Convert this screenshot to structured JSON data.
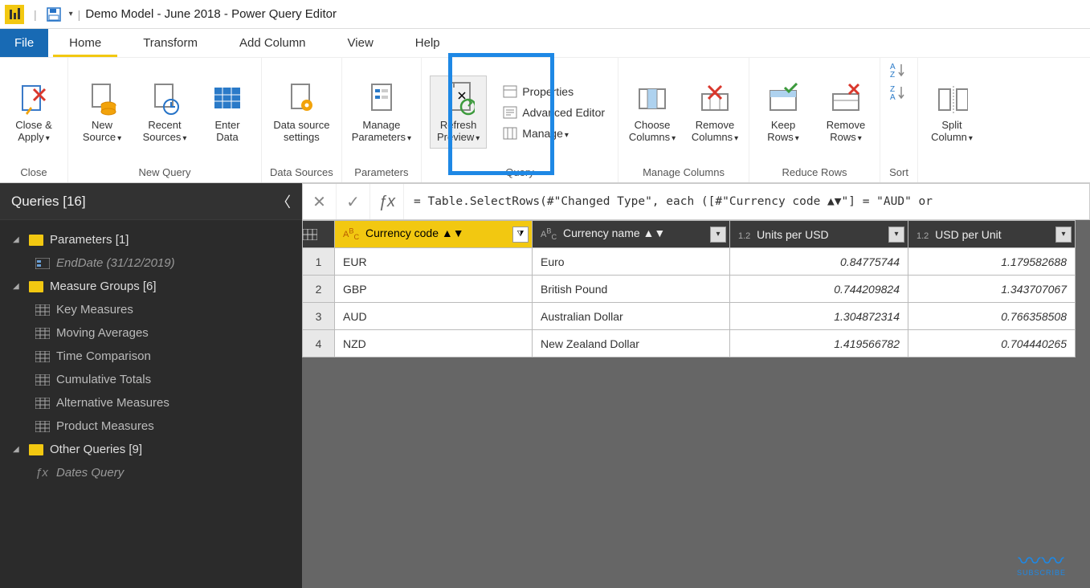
{
  "titlebar": {
    "title": "Demo Model - June 2018 - Power Query Editor"
  },
  "tabs": {
    "file": "File",
    "items": [
      "Home",
      "Transform",
      "Add Column",
      "View",
      "Help"
    ],
    "active": "Home"
  },
  "ribbon": {
    "close": {
      "close_apply": "Close &\nApply",
      "group": "Close"
    },
    "newquery": {
      "new_source": "New\nSource",
      "recent_sources": "Recent\nSources",
      "enter_data": "Enter\nData",
      "group": "New Query"
    },
    "datasources": {
      "settings": "Data source\nsettings",
      "group": "Data Sources"
    },
    "parameters": {
      "manage": "Manage\nParameters",
      "group": "Parameters"
    },
    "query": {
      "refresh": "Refresh\nPreview",
      "properties": "Properties",
      "advanced": "Advanced Editor",
      "manage": "Manage",
      "group": "Query"
    },
    "managecols": {
      "choose": "Choose\nColumns",
      "remove": "Remove\nColumns",
      "group": "Manage Columns"
    },
    "reducerows": {
      "keep": "Keep\nRows",
      "remove": "Remove\nRows",
      "group": "Reduce Rows"
    },
    "sort": {
      "group": "Sort"
    },
    "splitcol": {
      "split": "Split\nColumn"
    }
  },
  "sidebar": {
    "header": "Queries [16]",
    "groups": [
      {
        "name": "Parameters [1]",
        "type": "folder",
        "children": [
          {
            "name": "EndDate (31/12/2019)",
            "icon": "param",
            "italic": true
          }
        ]
      },
      {
        "name": "Measure Groups [6]",
        "type": "folder",
        "children": [
          {
            "name": "Key Measures",
            "icon": "table"
          },
          {
            "name": "Moving Averages",
            "icon": "table"
          },
          {
            "name": "Time Comparison",
            "icon": "table"
          },
          {
            "name": "Cumulative Totals",
            "icon": "table"
          },
          {
            "name": "Alternative Measures",
            "icon": "table"
          },
          {
            "name": "Product Measures",
            "icon": "table"
          }
        ]
      },
      {
        "name": "Other Queries [9]",
        "type": "folder",
        "children": [
          {
            "name": "Dates Query",
            "icon": "fx",
            "italic": true
          }
        ]
      }
    ]
  },
  "formula": "= Table.SelectRows(#\"Changed Type\", each ([#\"Currency code ▲▼\"] = \"AUD\" or",
  "columns": [
    {
      "type": "ABC",
      "label": "Currency code ▲▼",
      "sel": true,
      "filtered": true
    },
    {
      "type": "ABC",
      "label": "Currency name ▲▼"
    },
    {
      "type": "1.2",
      "label": "Units per USD"
    },
    {
      "type": "1.2",
      "label": "USD per Unit"
    }
  ],
  "rows": [
    {
      "n": "1",
      "c": [
        "EUR",
        "Euro",
        "0.84775744",
        "1.179582688"
      ]
    },
    {
      "n": "2",
      "c": [
        "GBP",
        "British Pound",
        "0.744209824",
        "1.343707067"
      ]
    },
    {
      "n": "3",
      "c": [
        "AUD",
        "Australian Dollar",
        "1.304872314",
        "0.766358508"
      ]
    },
    {
      "n": "4",
      "c": [
        "NZD",
        "New Zealand Dollar",
        "1.419566782",
        "0.704440265"
      ]
    }
  ]
}
